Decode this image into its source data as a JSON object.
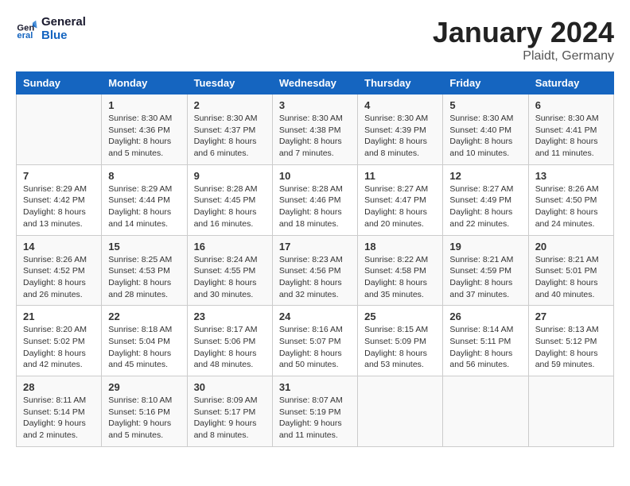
{
  "header": {
    "logo_line1": "General",
    "logo_line2": "Blue",
    "month": "January 2024",
    "location": "Plaidt, Germany"
  },
  "days_of_week": [
    "Sunday",
    "Monday",
    "Tuesday",
    "Wednesday",
    "Thursday",
    "Friday",
    "Saturday"
  ],
  "weeks": [
    [
      {
        "day": "",
        "content": ""
      },
      {
        "day": "1",
        "content": "Sunrise: 8:30 AM\nSunset: 4:36 PM\nDaylight: 8 hours\nand 5 minutes."
      },
      {
        "day": "2",
        "content": "Sunrise: 8:30 AM\nSunset: 4:37 PM\nDaylight: 8 hours\nand 6 minutes."
      },
      {
        "day": "3",
        "content": "Sunrise: 8:30 AM\nSunset: 4:38 PM\nDaylight: 8 hours\nand 7 minutes."
      },
      {
        "day": "4",
        "content": "Sunrise: 8:30 AM\nSunset: 4:39 PM\nDaylight: 8 hours\nand 8 minutes."
      },
      {
        "day": "5",
        "content": "Sunrise: 8:30 AM\nSunset: 4:40 PM\nDaylight: 8 hours\nand 10 minutes."
      },
      {
        "day": "6",
        "content": "Sunrise: 8:30 AM\nSunset: 4:41 PM\nDaylight: 8 hours\nand 11 minutes."
      }
    ],
    [
      {
        "day": "7",
        "content": "Sunrise: 8:29 AM\nSunset: 4:42 PM\nDaylight: 8 hours\nand 13 minutes."
      },
      {
        "day": "8",
        "content": "Sunrise: 8:29 AM\nSunset: 4:44 PM\nDaylight: 8 hours\nand 14 minutes."
      },
      {
        "day": "9",
        "content": "Sunrise: 8:28 AM\nSunset: 4:45 PM\nDaylight: 8 hours\nand 16 minutes."
      },
      {
        "day": "10",
        "content": "Sunrise: 8:28 AM\nSunset: 4:46 PM\nDaylight: 8 hours\nand 18 minutes."
      },
      {
        "day": "11",
        "content": "Sunrise: 8:27 AM\nSunset: 4:47 PM\nDaylight: 8 hours\nand 20 minutes."
      },
      {
        "day": "12",
        "content": "Sunrise: 8:27 AM\nSunset: 4:49 PM\nDaylight: 8 hours\nand 22 minutes."
      },
      {
        "day": "13",
        "content": "Sunrise: 8:26 AM\nSunset: 4:50 PM\nDaylight: 8 hours\nand 24 minutes."
      }
    ],
    [
      {
        "day": "14",
        "content": "Sunrise: 8:26 AM\nSunset: 4:52 PM\nDaylight: 8 hours\nand 26 minutes."
      },
      {
        "day": "15",
        "content": "Sunrise: 8:25 AM\nSunset: 4:53 PM\nDaylight: 8 hours\nand 28 minutes."
      },
      {
        "day": "16",
        "content": "Sunrise: 8:24 AM\nSunset: 4:55 PM\nDaylight: 8 hours\nand 30 minutes."
      },
      {
        "day": "17",
        "content": "Sunrise: 8:23 AM\nSunset: 4:56 PM\nDaylight: 8 hours\nand 32 minutes."
      },
      {
        "day": "18",
        "content": "Sunrise: 8:22 AM\nSunset: 4:58 PM\nDaylight: 8 hours\nand 35 minutes."
      },
      {
        "day": "19",
        "content": "Sunrise: 8:21 AM\nSunset: 4:59 PM\nDaylight: 8 hours\nand 37 minutes."
      },
      {
        "day": "20",
        "content": "Sunrise: 8:21 AM\nSunset: 5:01 PM\nDaylight: 8 hours\nand 40 minutes."
      }
    ],
    [
      {
        "day": "21",
        "content": "Sunrise: 8:20 AM\nSunset: 5:02 PM\nDaylight: 8 hours\nand 42 minutes."
      },
      {
        "day": "22",
        "content": "Sunrise: 8:18 AM\nSunset: 5:04 PM\nDaylight: 8 hours\nand 45 minutes."
      },
      {
        "day": "23",
        "content": "Sunrise: 8:17 AM\nSunset: 5:06 PM\nDaylight: 8 hours\nand 48 minutes."
      },
      {
        "day": "24",
        "content": "Sunrise: 8:16 AM\nSunset: 5:07 PM\nDaylight: 8 hours\nand 50 minutes."
      },
      {
        "day": "25",
        "content": "Sunrise: 8:15 AM\nSunset: 5:09 PM\nDaylight: 8 hours\nand 53 minutes."
      },
      {
        "day": "26",
        "content": "Sunrise: 8:14 AM\nSunset: 5:11 PM\nDaylight: 8 hours\nand 56 minutes."
      },
      {
        "day": "27",
        "content": "Sunrise: 8:13 AM\nSunset: 5:12 PM\nDaylight: 8 hours\nand 59 minutes."
      }
    ],
    [
      {
        "day": "28",
        "content": "Sunrise: 8:11 AM\nSunset: 5:14 PM\nDaylight: 9 hours\nand 2 minutes."
      },
      {
        "day": "29",
        "content": "Sunrise: 8:10 AM\nSunset: 5:16 PM\nDaylight: 9 hours\nand 5 minutes."
      },
      {
        "day": "30",
        "content": "Sunrise: 8:09 AM\nSunset: 5:17 PM\nDaylight: 9 hours\nand 8 minutes."
      },
      {
        "day": "31",
        "content": "Sunrise: 8:07 AM\nSunset: 5:19 PM\nDaylight: 9 hours\nand 11 minutes."
      },
      {
        "day": "",
        "content": ""
      },
      {
        "day": "",
        "content": ""
      },
      {
        "day": "",
        "content": ""
      }
    ]
  ]
}
